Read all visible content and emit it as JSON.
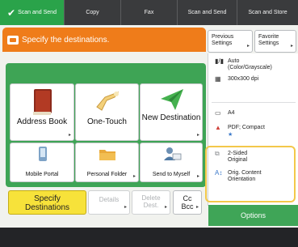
{
  "tabs": [
    {
      "label": "Scan and Send",
      "icon": "send-check-icon",
      "active": true
    },
    {
      "label": "Copy",
      "active": false
    },
    {
      "label": "Fax",
      "active": false
    },
    {
      "label": "Scan and Send",
      "active": false
    },
    {
      "label": "Scan and Store",
      "active": false
    }
  ],
  "header": {
    "title": "Specify the destinations."
  },
  "top_buttons": {
    "previous_settings": [
      "Previous",
      "Settings"
    ],
    "favorite_settings": [
      "Favorite",
      "Settings"
    ]
  },
  "destinations": {
    "address_book": "Address Book",
    "one_touch": "One-Touch",
    "new_destination": "New Destination",
    "mobile_portal": "Mobile Portal",
    "personal_folder": "Personal Folder",
    "send_to_myself": "Send to Myself"
  },
  "bottom_buttons": {
    "specify": [
      "Specify",
      "Destinations"
    ],
    "details": "Details",
    "delete": [
      "Delete",
      "Dest."
    ],
    "ccbcc": [
      "Cc",
      "Bcc"
    ]
  },
  "settings": {
    "color_mode": [
      "Auto",
      "(Color/Grayscale)"
    ],
    "resolution": "300x300 dpi",
    "paper_size": "A4",
    "file_format": "PDF; Compact",
    "sided": [
      "2-Sided",
      "Original"
    ],
    "orientation": [
      "Orig. Content",
      "Orientation"
    ]
  },
  "options_label": "Options",
  "colors": {
    "accent_green": "#3ea455",
    "header_orange": "#ef7c1a",
    "highlight_yellow": "#f7e23a"
  }
}
